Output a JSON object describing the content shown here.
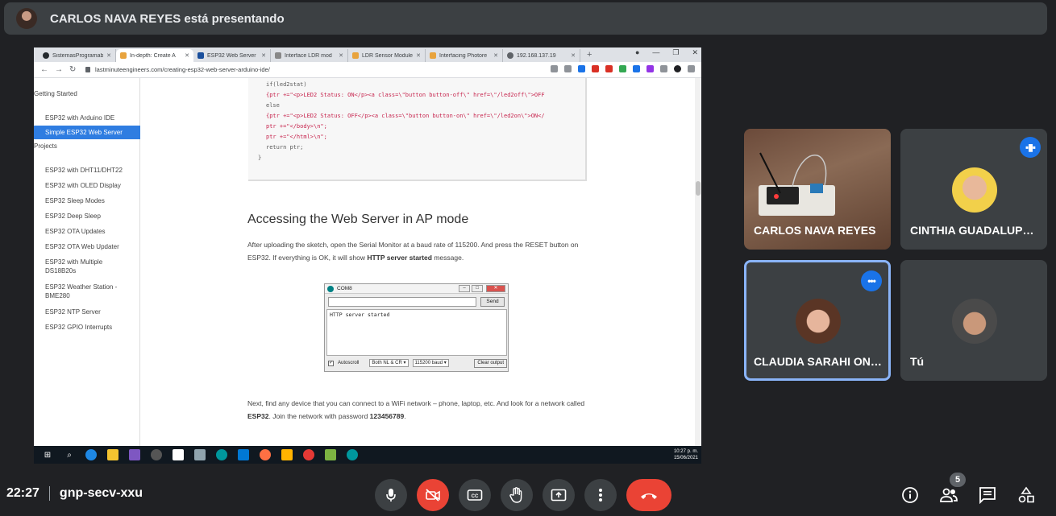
{
  "meet": {
    "presenter_banner": "CARLOS NAVA REYES está presentando",
    "time": "22:27",
    "meeting_code": "gnp-secv-xxu",
    "participants_count": "5",
    "participants": [
      {
        "name": "CARLOS NAVA REYES"
      },
      {
        "name": "CINTHIA GUADALUPE ..."
      },
      {
        "name": "CLAUDIA SARAHI ONT..."
      },
      {
        "name": "Tú"
      }
    ]
  },
  "browser": {
    "tabs": [
      "SistemasProgramab",
      "In-depth: Create A",
      "ESP32 Web Server",
      "Interface LDR mod",
      "LDR Sensor Module",
      "Interfacing Photore",
      "192.168.137.19"
    ],
    "new_tab": "+",
    "url": "lastminuteengineers.com/creating-esp32-web-server-arduino-ide/"
  },
  "sidebar": {
    "heading_getting_started": "Getting Started",
    "item_ide": "ESP32 with Arduino IDE",
    "item_active": "Simple ESP32 Web Server",
    "heading_projects": "Projects",
    "projects": [
      "ESP32 with DHT11/DHT22",
      "ESP32 with OLED Display",
      "ESP32 Sleep Modes",
      "ESP32 Deep Sleep",
      "ESP32 OTA Updates",
      "ESP32 OTA Web Updater",
      "ESP32 with Multiple DS18B20s",
      "ESP32 Weather Station - BME280",
      "ESP32 NTP Server",
      "ESP32 GPIO Interrupts"
    ]
  },
  "article": {
    "code_lines": [
      "if(led2stat)",
      "{ptr +=\"<p>LED2 Status: ON</p><a class=\\\"button button-off\\\" href=\\\"/led2off\\\">OFF",
      "else",
      "{ptr +=\"<p>LED2 Status: OFF</p><a class=\\\"button button-on\\\" href=\\\"/led2on\\\">ON</",
      "",
      "ptr +=\"</body>\\n\";",
      "ptr +=\"</html>\\n\";",
      "return ptr;",
      "}"
    ],
    "heading": "Accessing the Web Server in AP mode",
    "p1_a": "After uploading the sketch, open the Serial Monitor at a baud rate of 115200. And press the RESET button on ESP32. If everything is OK, it will show ",
    "p1_b": "HTTP server started",
    "p1_c": " message.",
    "p2_a": "Next, find any device that you can connect to a WiFi network – phone, laptop, etc. And look for a network called ",
    "p2_b": "ESP32",
    "p2_c": ". Join the network with password ",
    "p2_d": "123456789",
    "p2_e": "."
  },
  "serial_monitor": {
    "title": "COM8",
    "send": "Send",
    "output": "HTTP server started",
    "autoscroll": "Autoscroll",
    "line_ending": "Both NL & CR",
    "baud": "115200 baud",
    "clear": "Clear output"
  },
  "taskbar": {
    "time": "10:27 p. m.",
    "date": "15/06/2021"
  }
}
